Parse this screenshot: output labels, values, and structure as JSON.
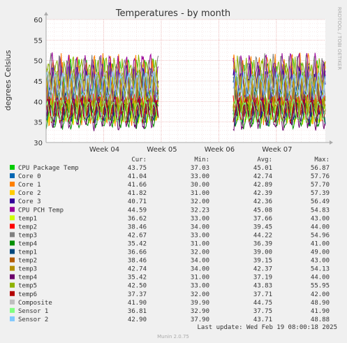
{
  "chart_data": {
    "type": "line",
    "title": "Temperatures - by month",
    "ylabel": "degrees Celsius",
    "ylim": [
      30,
      60
    ],
    "yticks": [
      30,
      35,
      40,
      45,
      50,
      55,
      60
    ],
    "xlim_weeks": [
      3.0,
      7.85
    ],
    "xticks": [
      {
        "label": "Week 04",
        "week": 4
      },
      {
        "label": "Week 05",
        "week": 5
      },
      {
        "label": "Week 06",
        "week": 6
      },
      {
        "label": "Week 07",
        "week": 7
      }
    ],
    "data_segments_weeks": [
      [
        3.0,
        4.95
      ],
      [
        6.25,
        7.85
      ]
    ],
    "grid": true,
    "side_label": "RRDTOOL / TOBI OETIKER",
    "legend_columns": [
      "Cur:",
      "Min:",
      "Avg:",
      "Max:"
    ],
    "series": [
      {
        "name": "CPU Package Temp",
        "color": "#00cc00",
        "cur": "43.75",
        "min": "37.03",
        "avg": "45.01",
        "max": "56.87"
      },
      {
        "name": "Core 0",
        "color": "#0066b3",
        "cur": "41.04",
        "min": "33.00",
        "avg": "42.74",
        "max": "57.76"
      },
      {
        "name": "Core 1",
        "color": "#ff8000",
        "cur": "41.66",
        "min": "30.00",
        "avg": "42.89",
        "max": "57.70"
      },
      {
        "name": "Core 2",
        "color": "#ffcc00",
        "cur": "41.82",
        "min": "31.00",
        "avg": "42.39",
        "max": "57.39"
      },
      {
        "name": "Core 3",
        "color": "#330099",
        "cur": "40.71",
        "min": "32.00",
        "avg": "42.36",
        "max": "56.49"
      },
      {
        "name": "CPU PCH Temp",
        "color": "#990099",
        "cur": "44.59",
        "min": "32.23",
        "avg": "45.08",
        "max": "54.83"
      },
      {
        "name": "temp1",
        "color": "#ccff00",
        "cur": "36.62",
        "min": "33.00",
        "avg": "37.66",
        "max": "43.00"
      },
      {
        "name": "temp2",
        "color": "#ff0000",
        "cur": "38.46",
        "min": "34.00",
        "avg": "39.45",
        "max": "44.00"
      },
      {
        "name": "temp3",
        "color": "#808080",
        "cur": "42.67",
        "min": "33.00",
        "avg": "44.22",
        "max": "54.96"
      },
      {
        "name": "temp4",
        "color": "#008f00",
        "cur": "35.42",
        "min": "31.00",
        "avg": "36.39",
        "max": "41.00"
      },
      {
        "name": "temp1",
        "color": "#00487d",
        "cur": "36.66",
        "min": "32.00",
        "avg": "39.00",
        "max": "49.00"
      },
      {
        "name": "temp2",
        "color": "#b35a00",
        "cur": "38.46",
        "min": "34.00",
        "avg": "39.15",
        "max": "43.00"
      },
      {
        "name": "temp3",
        "color": "#b38f00",
        "cur": "42.74",
        "min": "34.00",
        "avg": "42.37",
        "max": "54.13"
      },
      {
        "name": "temp4",
        "color": "#6b006b",
        "cur": "35.42",
        "min": "31.00",
        "avg": "37.19",
        "max": "44.00"
      },
      {
        "name": "temp5",
        "color": "#8fb300",
        "cur": "42.50",
        "min": "33.00",
        "avg": "43.83",
        "max": "55.95"
      },
      {
        "name": "temp6",
        "color": "#b30000",
        "cur": "37.37",
        "min": "32.00",
        "avg": "37.71",
        "max": "42.00"
      },
      {
        "name": "Composite",
        "color": "#bebebe",
        "cur": "41.90",
        "min": "39.90",
        "avg": "44.75",
        "max": "48.90"
      },
      {
        "name": "Sensor 1",
        "color": "#80ff80",
        "cur": "36.81",
        "min": "32.90",
        "avg": "37.75",
        "max": "41.90"
      },
      {
        "name": "Sensor 2",
        "color": "#80c9ff",
        "cur": "42.90",
        "min": "37.90",
        "avg": "43.71",
        "max": "48.88"
      }
    ],
    "last_update": "Last update: Wed Feb 19 08:00:18 2025",
    "footer": "Munin 2.0.75"
  }
}
